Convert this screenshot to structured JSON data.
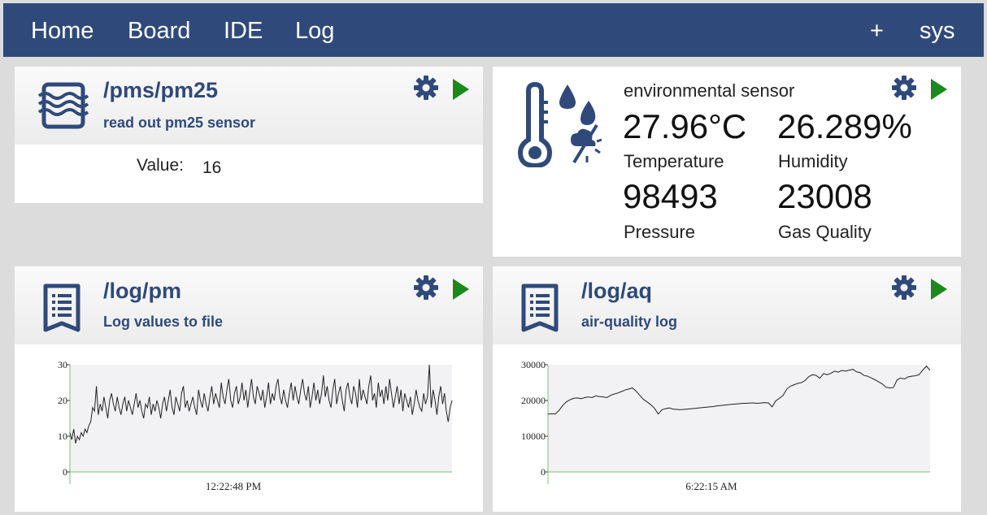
{
  "nav": {
    "home": "Home",
    "board": "Board",
    "ide": "IDE",
    "log": "Log",
    "plus": "+",
    "sys": "sys"
  },
  "cards": {
    "pm25": {
      "title": "/pms/pm25",
      "subtitle": "read out pm25 sensor",
      "value_label": "Value:",
      "value": "16",
      "icon": "waves-box-icon"
    },
    "env": {
      "title": "environmental sensor",
      "icon": "thermometer-weather-icon",
      "temperature": "27.96°C",
      "temperature_label": "Temperature",
      "humidity": "26.289%",
      "humidity_label": "Humidity",
      "pressure": "98493",
      "pressure_label": "Pressure",
      "gas": "23008",
      "gas_label": "Gas Quality"
    },
    "logpm": {
      "title": "/log/pm",
      "subtitle": "Log values to file",
      "icon": "log-document-icon"
    },
    "logaq": {
      "title": "/log/aq",
      "subtitle": "air-quality log",
      "icon": "log-document-icon"
    }
  },
  "colors": {
    "nav_bg": "#2f4a7a",
    "accent": "#2f4a7a",
    "play_green": "#1a8a1a",
    "plot_bg": "#f2f1f3",
    "axis_green": "#7ac27a"
  },
  "chart_data": [
    {
      "type": "line",
      "yticks": [
        "30",
        "20",
        "10",
        "0"
      ],
      "ylim": [
        0,
        30
      ],
      "xlabel": "12:22:48 PM",
      "series": [
        {
          "values": [
            11,
            9,
            12,
            8,
            10,
            9,
            11,
            10,
            12,
            11,
            13,
            14,
            18,
            17,
            24,
            16,
            19,
            17,
            21,
            18,
            15,
            20,
            22,
            19,
            17,
            21,
            18,
            16,
            19,
            21,
            17,
            20,
            18,
            16,
            19,
            22,
            18,
            20,
            17,
            15,
            19,
            18,
            21,
            16,
            19,
            17,
            20,
            18,
            15,
            19,
            21,
            17,
            20,
            23,
            18,
            16,
            21,
            19,
            17,
            22,
            24,
            18,
            20,
            17,
            19,
            21,
            18,
            16,
            23,
            20,
            18,
            22,
            19,
            17,
            21,
            24,
            19,
            22,
            20,
            18,
            25,
            21,
            19,
            23,
            26,
            20,
            18,
            22,
            24,
            19,
            21,
            25,
            20,
            23,
            18,
            22,
            26,
            21,
            19,
            24,
            22,
            20,
            23,
            18,
            21,
            25,
            19,
            22,
            20,
            24,
            26,
            21,
            19,
            23,
            20,
            18,
            22,
            25,
            20,
            24,
            21,
            19,
            23,
            26,
            22,
            20,
            24,
            18,
            21,
            25,
            20,
            23,
            19,
            22,
            27,
            21,
            24,
            20,
            18,
            23,
            26,
            19,
            22,
            24,
            20,
            17,
            23,
            25,
            21,
            19,
            24,
            22,
            18,
            26,
            20,
            23,
            21,
            19,
            24,
            27,
            20,
            22,
            18,
            25,
            21,
            23,
            19,
            24,
            20,
            26,
            22,
            18,
            21,
            24,
            19,
            23,
            17,
            22,
            20,
            18,
            21,
            16,
            19,
            23,
            20,
            18,
            17,
            22,
            19,
            21,
            30,
            18,
            23,
            20,
            16,
            21,
            24,
            19,
            22,
            17,
            14,
            18,
            20
          ]
        }
      ]
    },
    {
      "type": "line",
      "yticks": [
        "30000",
        "20000",
        "10000",
        "0"
      ],
      "ylim": [
        0,
        30000
      ],
      "xlabel": "6:22:15 AM",
      "series": [
        {
          "values": [
            16200,
            16300,
            16200,
            17200,
            18600,
            19600,
            20200,
            20600,
            20700,
            20500,
            20800,
            21000,
            20800,
            21300,
            21100,
            21000,
            20800,
            21400,
            21800,
            22100,
            22500,
            22900,
            23200,
            23500,
            22600,
            21400,
            20300,
            19600,
            18800,
            17800,
            16200,
            17400,
            17700,
            17900,
            17600,
            17500,
            17400,
            17500,
            17600,
            17700,
            17800,
            17900,
            18000,
            18100,
            18200,
            18300,
            18500,
            18600,
            18700,
            18800,
            18900,
            19000,
            19100,
            19200,
            19200,
            19300,
            19300,
            19200,
            19300,
            19400,
            19300,
            18200,
            19900,
            20600,
            21400,
            23200,
            24000,
            24400,
            24800,
            25000,
            25600,
            26700,
            27200,
            27000,
            26200,
            27500,
            27200,
            27600,
            28200,
            27900,
            28400,
            28200,
            28500,
            28700,
            28000,
            27800,
            27000,
            26800,
            26300,
            25800,
            25200,
            24600,
            23700,
            23500,
            23600,
            25700,
            26300,
            26000,
            26600,
            26800,
            26900,
            27200,
            28500,
            29600,
            28400
          ]
        }
      ]
    }
  ]
}
